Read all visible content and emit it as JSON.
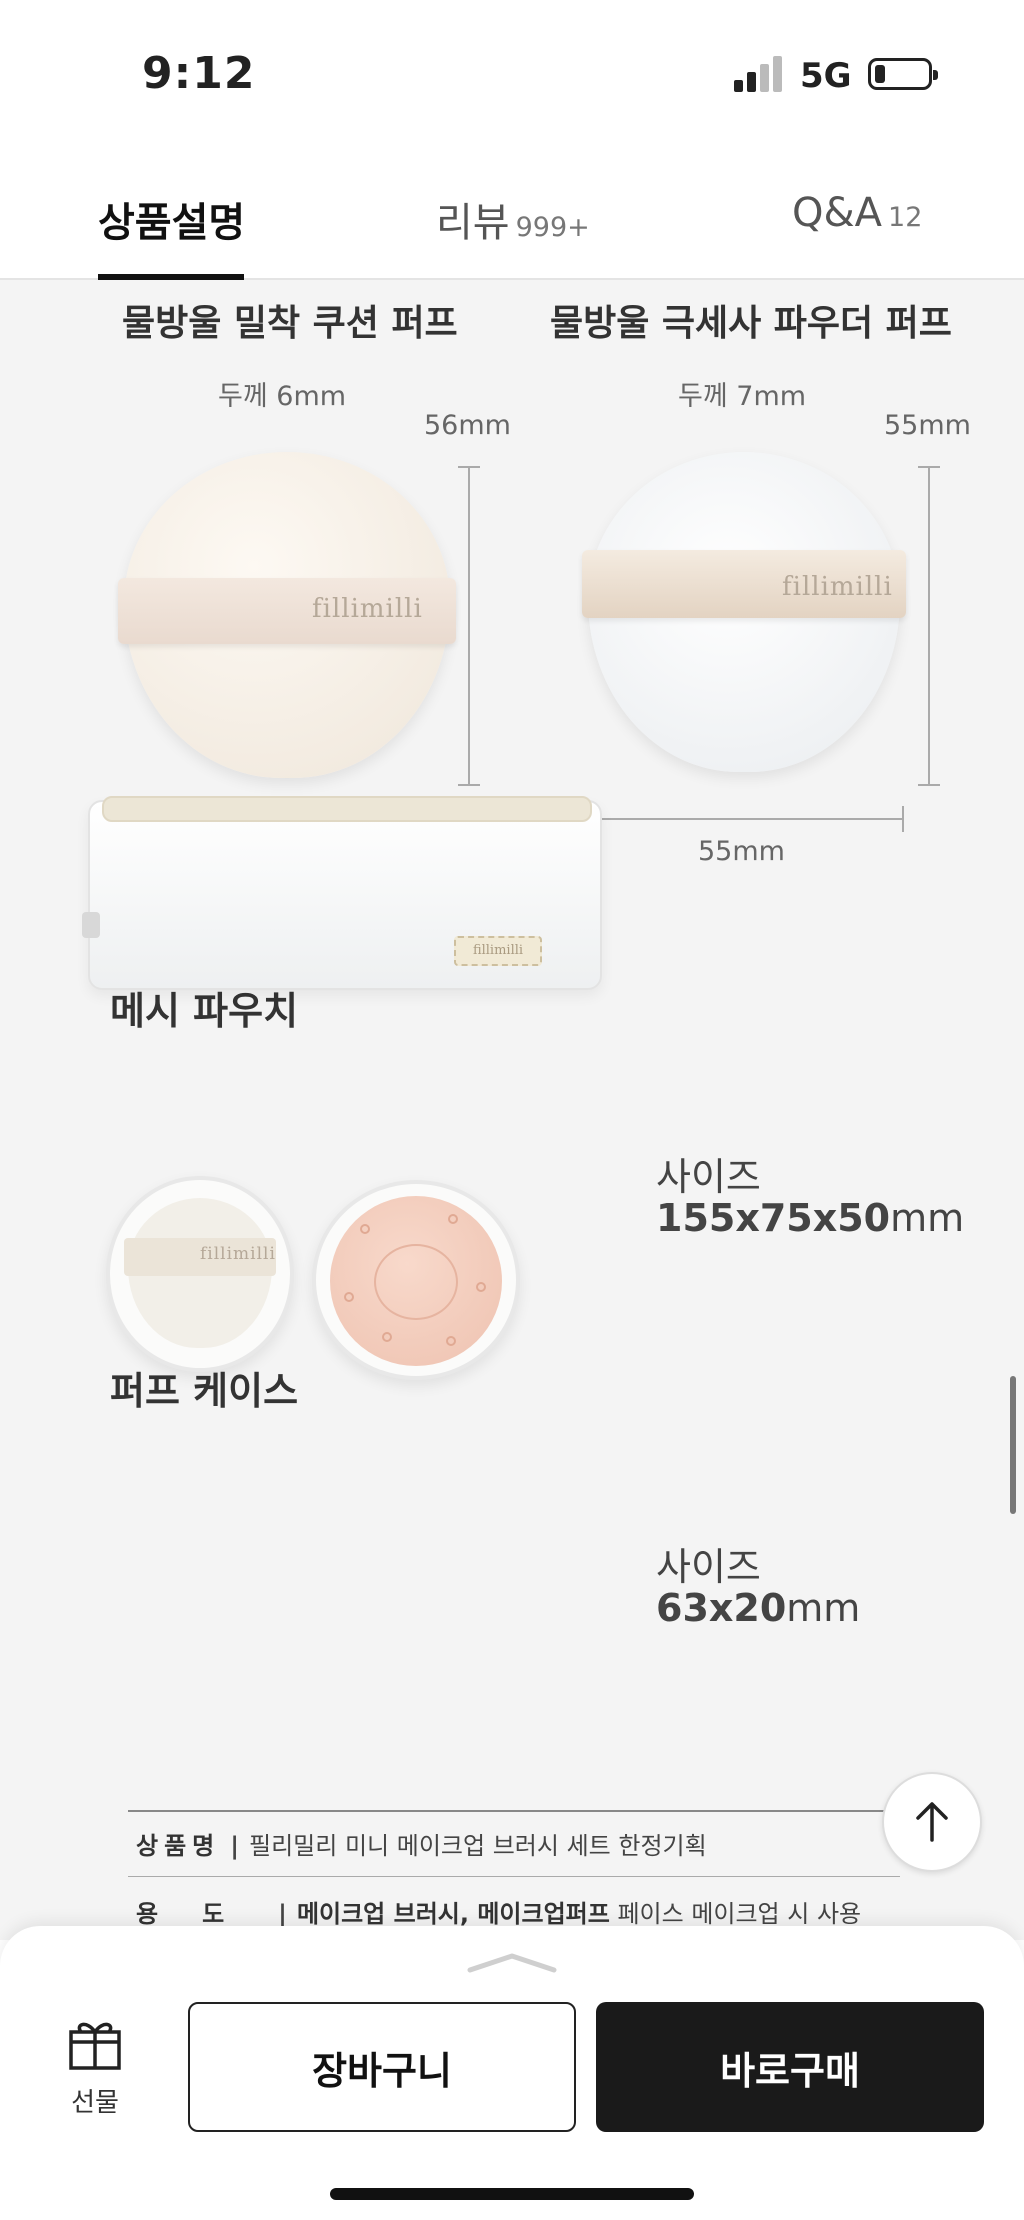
{
  "status": {
    "time": "9:12",
    "network": "5G"
  },
  "tabs": [
    {
      "label": "상품설명",
      "count": ""
    },
    {
      "label": "리뷰",
      "count": "999+"
    },
    {
      "label": "Q&A",
      "count": "12"
    }
  ],
  "puffs": [
    {
      "title": "물방울 밀착 쿠션 퍼프",
      "thickness": "두께 6mm",
      "height": "56mm",
      "width": "55mm",
      "brand": "fillimilli"
    },
    {
      "title": "물방울 극세사 파우더 퍼프",
      "thickness": "두께 7mm",
      "height": "55mm",
      "width": "55mm",
      "brand": "fillimilli"
    }
  ],
  "pouch": {
    "title": "메시 파우치",
    "size_label": "사이즈",
    "size_value": "155x75x50",
    "unit": "mm",
    "brand": "fillimilli"
  },
  "case": {
    "title": "퍼프 케이스",
    "size_label": "사이즈",
    "size_value": "63x20",
    "unit": "mm",
    "brand": "fillimilli"
  },
  "specs": [
    {
      "key": "상품명",
      "value_bold": "",
      "value": "필리밀리 미니 메이크업 브러시 세트 한정기획"
    },
    {
      "key": "용도",
      "value_bold": "메이크업 브러시, 메이크업퍼프",
      "value": "페이스 메이크업 시 사용"
    }
  ],
  "bottom": {
    "gift_label": "선물",
    "cart_label": "장바구니",
    "buy_label": "바로구매"
  }
}
